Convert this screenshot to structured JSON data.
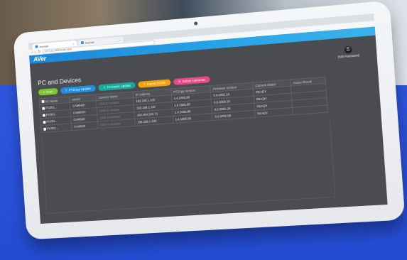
{
  "browser": {
    "tabs": [
      {
        "label": "Avertab"
      },
      {
        "label": "Avertab"
      }
    ],
    "url": "127.0.0.1:8080/index.html",
    "close_glyph": "×",
    "nav": {
      "back": "‹",
      "forward": "›",
      "reload": "↻"
    }
  },
  "app": {
    "logo": "AVer",
    "page_title": "PC and Devices",
    "edit_password": {
      "label": "Edit Password",
      "icon": "key-icon",
      "glyph": "⚿"
    }
  },
  "toolbar": {
    "buttons": [
      {
        "label": "Scan",
        "icon": "search-icon",
        "glyph": "⌕",
        "color": "#7ec72f"
      },
      {
        "label": "PTZApp Update",
        "icon": "upload-icon",
        "glyph": "⇪",
        "color": "#1f8fdf"
      },
      {
        "label": "Firmware Update",
        "icon": "upload-icon",
        "glyph": "⇪",
        "color": "#18a89e"
      },
      {
        "label": "Import Profile",
        "icon": "import-icon",
        "glyph": "⇩",
        "color": "#f0a30a"
      },
      {
        "label": "Delete Cameras",
        "icon": "trash-icon",
        "glyph": "✕",
        "color": "#e84a86"
      }
    ]
  },
  "table": {
    "columns": [
      "PC Name",
      "Model",
      "Camera Name",
      "IP Address",
      "PTZApp Version",
      "Firmware Version",
      "Camera Status",
      "Action Result"
    ],
    "rows": [
      {
        "pc": "PC001...",
        "model": "CAM540+",
        "camera": "Click to rename",
        "ip": "192.168.1.102",
        "ptz": "1.4.1005.89",
        "fw": "0.0.1001.18",
        "status": "READY",
        "result": ""
      },
      {
        "pc": "PC001...",
        "model": "CAM540+",
        "camera": "Click to rename",
        "ip": "192.168.1.110",
        "ptz": "1.4.1005.89",
        "fw": "0.0.1000.18",
        "status": "READY",
        "result": ""
      },
      {
        "pc": "PC001...",
        "model": "CAM540",
        "camera": "Click to rename",
        "ip": "164.254.243.73",
        "ptz": "1.4.1005.89",
        "fw": "0.0.0002.26",
        "status": "READY",
        "result": ""
      },
      {
        "pc": "PC001...",
        "model": "CAM540",
        "camera": "Click to rename",
        "ip": "192.168.1.150",
        "ptz": "1.4.1005.89",
        "fw": "0.0.0002.58",
        "status": "READY",
        "result": ""
      }
    ]
  }
}
